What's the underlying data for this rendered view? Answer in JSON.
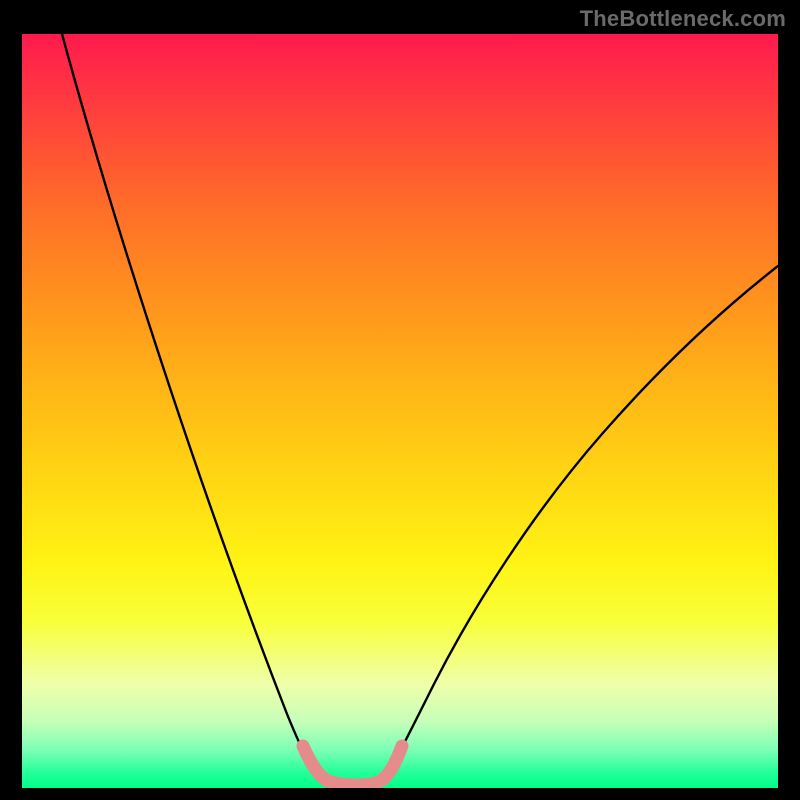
{
  "watermark": "TheBottleneck.com",
  "chart_data": {
    "type": "line",
    "title": "",
    "xlabel": "",
    "ylabel": "",
    "xlim": [
      0,
      100
    ],
    "ylim": [
      0,
      100
    ],
    "series": [
      {
        "name": "black-curve-left",
        "x": [
          5,
          8,
          12,
          16,
          20,
          24,
          28,
          31,
          34,
          36,
          38
        ],
        "y": [
          100,
          90,
          78,
          66,
          54,
          42,
          30,
          20,
          11,
          6,
          3
        ]
      },
      {
        "name": "black-curve-right",
        "x": [
          48,
          50,
          53,
          57,
          62,
          68,
          75,
          83,
          92,
          100
        ],
        "y": [
          3,
          6,
          12,
          20,
          30,
          40,
          50,
          58,
          65,
          70
        ]
      },
      {
        "name": "pink-valley",
        "x": [
          37,
          38,
          39.5,
          41,
          43,
          45,
          46.5,
          48,
          49
        ],
        "y": [
          5,
          3,
          1.7,
          1.2,
          1.2,
          1.2,
          1.7,
          3,
          5
        ]
      }
    ],
    "colors": {
      "black_curve": "#000000",
      "pink_valley": "#e58b8b",
      "gradient_top": "#ff1a4d",
      "gradient_bottom": "#00ff88"
    }
  }
}
